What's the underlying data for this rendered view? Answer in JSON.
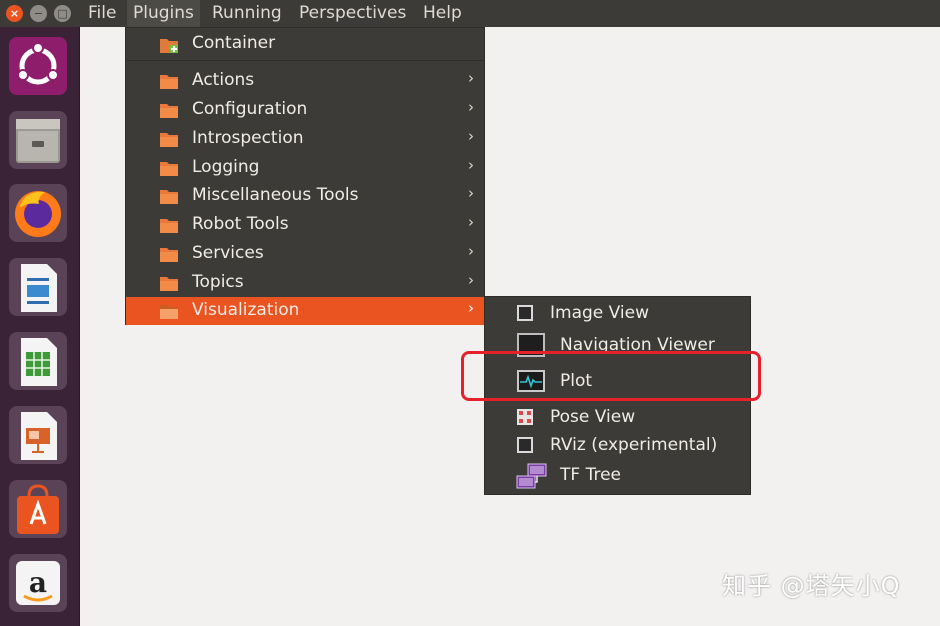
{
  "window_controls": {
    "close_glyph": "×",
    "minimize_glyph": "−",
    "maximize_glyph": "□"
  },
  "menubar": [
    "File",
    "Plugins",
    "Running",
    "Perspectives",
    "Help"
  ],
  "plugins_menu": {
    "top_item": "Container",
    "items": [
      "Actions",
      "Configuration",
      "Introspection",
      "Logging",
      "Miscellaneous Tools",
      "Robot Tools",
      "Services",
      "Topics",
      "Visualization"
    ],
    "highlighted": "Visualization",
    "submenu_arrow": "›"
  },
  "visualization_submenu": [
    "Image View",
    "Navigation Viewer",
    "Plot",
    "Pose View",
    "RViz (experimental)",
    "TF Tree"
  ],
  "watermark": "知乎 @塔矢小Q",
  "colors": {
    "accent": "#e95420",
    "menu_bg": "#3c3b37",
    "launcher_bg": "#3a2337",
    "annotation": "#e8202a"
  },
  "launcher_icons": [
    "ubuntu-icon",
    "file-manager-icon",
    "firefox-icon",
    "writer-icon",
    "calc-icon",
    "impress-icon",
    "software-center-icon",
    "amazon-icon"
  ]
}
